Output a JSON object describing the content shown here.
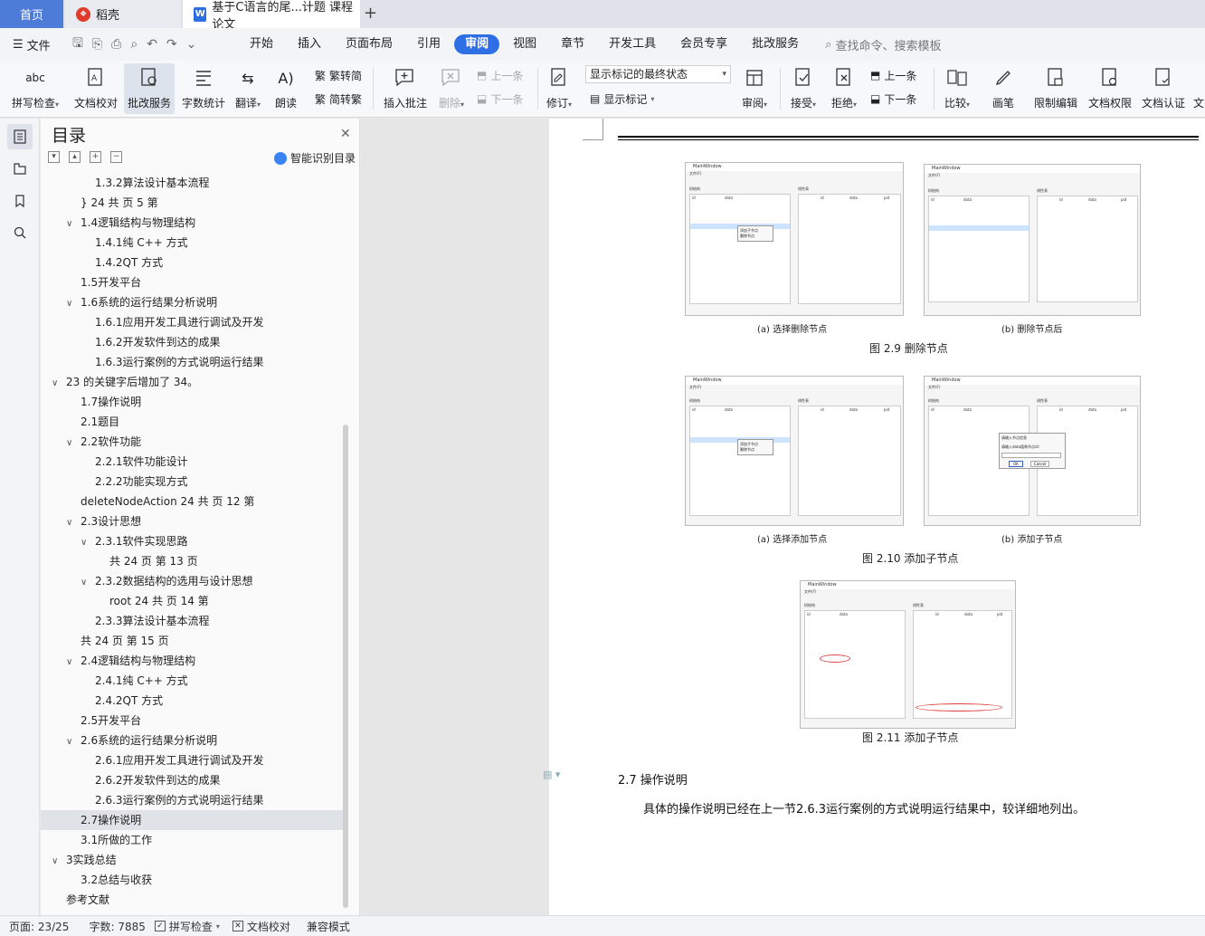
{
  "tabs": {
    "home": "首页",
    "daoke": "稻壳",
    "doc": "基于C语言的尾...计题 课程论文"
  },
  "menu": {
    "file": "文件",
    "items": [
      "开始",
      "插入",
      "页面布局",
      "引用",
      "审阅",
      "视图",
      "章节",
      "开发工具",
      "会员专享",
      "批改服务"
    ],
    "active": "审阅",
    "search_placeholder": "查找命令、搜索模板"
  },
  "ribbon": {
    "spellcheck": "拼写检查",
    "proofread": "文档校对",
    "correct_service": "批改服务",
    "word_count": "字数统计",
    "translate": "翻译",
    "read_aloud": "朗读",
    "trad_to_simp": "繁转简",
    "simp_to_trad": "简转繁",
    "insert_comment": "插入批注",
    "delete": "删除",
    "prev": "上一条",
    "next": "下一条",
    "track": "修订",
    "markup_state": "显示标记的最终状态",
    "show_markup": "显示标记",
    "review": "审阅",
    "accept": "接受",
    "reject": "拒绝",
    "prev2": "上一条",
    "next2": "下一条",
    "compare": "比较",
    "ink": "画笔",
    "restrict": "限制编辑",
    "permission": "文档权限",
    "certify": "文档认证",
    "more": "文"
  },
  "toc": {
    "title": "目录",
    "smart": "智能识别目录",
    "items": [
      {
        "text": "1.3.2算法设计基本流程",
        "level": 3,
        "chev": false
      },
      {
        "text": "}  24  共  页 5 第",
        "level": 2,
        "chev": false
      },
      {
        "text": "1.4逻辑结构与物理结构",
        "level": 2,
        "chev": true
      },
      {
        "text": "1.4.1纯 C++ 方式",
        "level": 3,
        "chev": false
      },
      {
        "text": "1.4.2QT 方式",
        "level": 3,
        "chev": false
      },
      {
        "text": "1.5开发平台",
        "level": 2,
        "chev": false
      },
      {
        "text": "1.6系统的运行结果分析说明",
        "level": 2,
        "chev": true
      },
      {
        "text": "1.6.1应用开发工具进行调试及开发",
        "level": 3,
        "chev": false
      },
      {
        "text": "1.6.2开发软件到达的成果",
        "level": 3,
        "chev": false
      },
      {
        "text": "1.6.3运行案例的方式说明运行结果",
        "level": 3,
        "chev": false
      },
      {
        "text": "23 的关键字后增加了 34。",
        "level": 1,
        "chev": true
      },
      {
        "text": "1.7操作说明",
        "level": 2,
        "chev": false
      },
      {
        "text": "2.1题目",
        "level": 2,
        "chev": false
      },
      {
        "text": "2.2软件功能",
        "level": 2,
        "chev": true
      },
      {
        "text": "2.2.1软件功能设计",
        "level": 3,
        "chev": false
      },
      {
        "text": "2.2.2功能实现方式",
        "level": 3,
        "chev": false
      },
      {
        "text": "deleteNodeAction  24  共 页 12 第",
        "level": 2,
        "chev": false
      },
      {
        "text": "2.3设计思想",
        "level": 2,
        "chev": true
      },
      {
        "text": "2.3.1软件实现思路",
        "level": 3,
        "chev": true
      },
      {
        "text": "共 24  页  第  13 页",
        "level": 4,
        "chev": false
      },
      {
        "text": "2.3.2数据结构的选用与设计思想",
        "level": 3,
        "chev": true
      },
      {
        "text": "root  24  共 页 14 第",
        "level": 4,
        "chev": false
      },
      {
        "text": "2.3.3算法设计基本流程",
        "level": 3,
        "chev": false
      },
      {
        "text": "共 24  页  第  15 页",
        "level": 2,
        "chev": false
      },
      {
        "text": "2.4逻辑结构与物理结构",
        "level": 2,
        "chev": true
      },
      {
        "text": "2.4.1纯 C++ 方式",
        "level": 3,
        "chev": false
      },
      {
        "text": "2.4.2QT 方式",
        "level": 3,
        "chev": false
      },
      {
        "text": "2.5开发平台",
        "level": 2,
        "chev": false
      },
      {
        "text": "2.6系统的运行结果分析说明",
        "level": 2,
        "chev": true
      },
      {
        "text": "2.6.1应用开发工具进行调试及开发",
        "level": 3,
        "chev": false
      },
      {
        "text": "2.6.2开发软件到达的成果",
        "level": 3,
        "chev": false
      },
      {
        "text": "2.6.3运行案例的方式说明运行结果",
        "level": 3,
        "chev": false
      },
      {
        "text": "2.7操作说明",
        "level": 2,
        "chev": false,
        "active": true
      },
      {
        "text": "3.1所做的工作",
        "level": 2,
        "chev": false
      },
      {
        "text": "3实践总结",
        "level": 1,
        "chev": true
      },
      {
        "text": "3.2总结与收获",
        "level": 2,
        "chev": false
      },
      {
        "text": "参考文献",
        "level": 1,
        "chev": false
      }
    ]
  },
  "doc": {
    "fig29a": "(a)  选择删除节点",
    "fig29b": "(b)  删除节点后",
    "fig29": "图  2.9 删除节点",
    "fig210a": "(a)  选择添加节点",
    "fig210b": "(b)  添加子节点",
    "fig210": "图  2.10 添加子节点",
    "fig211": "图  2.11 添加子节点",
    "heading": "2.7 操作说明",
    "para": "具体的操作说明已经在上一节2.6.3运行案例的方式说明运行结果中，较详细地列出。",
    "mw": "MainWindow",
    "file_menu": "文件(F)",
    "tree_lbl": "树结构",
    "list_lbl": "线性表",
    "col_id": "id",
    "col_data": "data",
    "col_pid": "pid",
    "ctx_add": "添加子节点",
    "ctx_del": "删除节点",
    "dlg_title": "请输入节点信息",
    "dlg_prompt": "请输入data值和节点id：",
    "dlg_ok": "OK",
    "dlg_cancel": "Cancel"
  },
  "status": {
    "page": "页面: 23/25",
    "words": "字数: 7885",
    "spell": "拼写检查",
    "proof": "文档校对",
    "compat": "兼容模式"
  }
}
